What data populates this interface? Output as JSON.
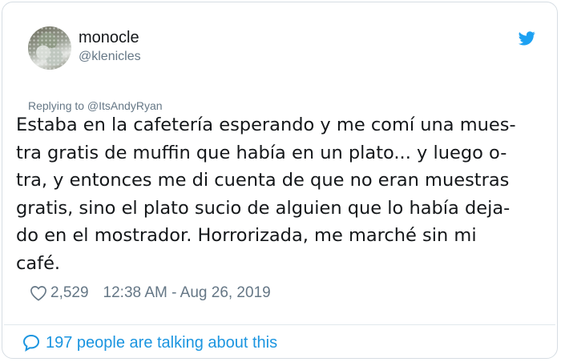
{
  "user": {
    "display_name": "monocle",
    "handle": "@klenicles"
  },
  "reply": {
    "text": "Replying to @ItsAndyRyan"
  },
  "tweet": {
    "lines": [
      "Estaba en la cafetería esperando y me comí una mues-",
      "tra gratis de muffin que había en un plato... y luego o-",
      "tra, y entonces me di cuenta de que no eran muestras",
      "gratis, sino el plato sucio de alguien que lo había deja-",
      "do en el mostrador. Horrorizada, me marché sin mi",
      "café."
    ]
  },
  "stats": {
    "likes": "2,529",
    "timestamp": "12:38 AM - Aug 26, 2019"
  },
  "footer": {
    "text": "197 people are talking about this"
  },
  "icons": {
    "brand": "twitter-bird-icon",
    "like": "heart-icon",
    "reply": "speech-bubble-icon"
  },
  "colors": {
    "accent": "#1da1f2",
    "link": "#1b95e0",
    "muted": "#657786",
    "text": "#14171a"
  }
}
